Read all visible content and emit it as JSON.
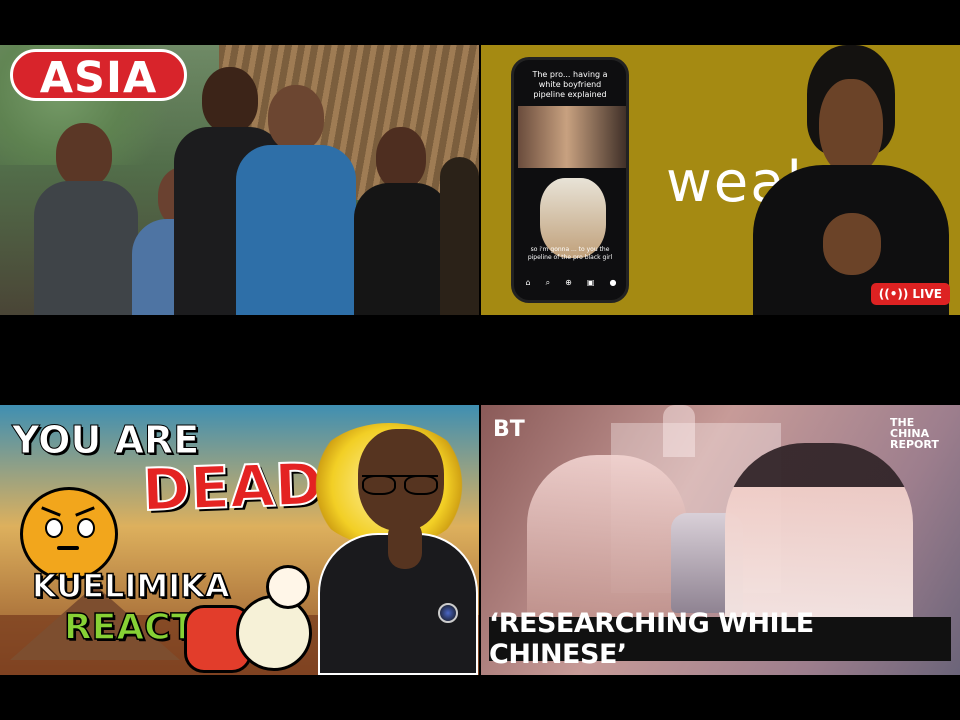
{
  "thumbnails": [
    {
      "id": "asia",
      "badge_text": "ASIA"
    },
    {
      "id": "weakness",
      "phone": {
        "top_text": "The pro... having a white boyfriend pipeline explained",
        "caption": "so i'm gonna ... to you the pipeline of the pro black girl",
        "nav_icons": [
          "home-icon",
          "search-icon",
          "plus-icon",
          "reels-icon",
          "profile-icon"
        ]
      },
      "overlay_text": "weak   s",
      "live_badge": "LIVE"
    },
    {
      "id": "dead",
      "line1": "YOU ARE",
      "line2": "DEAD",
      "line3": "KUELIMIKA",
      "line4": "REACTS"
    },
    {
      "id": "china",
      "logo": "BT",
      "brand": "THE CHINA REPORT",
      "headline": "‘RESEARCHING WHILE CHINESE’"
    }
  ],
  "colors": {
    "background": "#000000",
    "asia_badge": "#d8242b",
    "weak_bg": "#a58a12",
    "live_red": "#dd2222",
    "dead_red": "#e42322",
    "reacts_green": "#87d135"
  }
}
